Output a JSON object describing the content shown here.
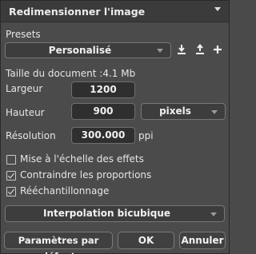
{
  "header": {
    "title": "Redimensionner l'image"
  },
  "presets": {
    "label": "Presets",
    "selected": "Personalisé"
  },
  "doc_size": {
    "label": "Taille du document :",
    "value": "4.1 Mb"
  },
  "width": {
    "label": "Largeur",
    "value": "1200"
  },
  "height": {
    "label": "Hauteur",
    "value": "900",
    "unit": "pixels"
  },
  "resolution": {
    "label": "Résolution",
    "value": "300.000",
    "unit": "ppi"
  },
  "options": [
    {
      "label": "Mise à l'échelle des effets",
      "checked": false
    },
    {
      "label": "Contraindre les proportions",
      "checked": true
    },
    {
      "label": "Rééchantillonnage",
      "checked": true
    }
  ],
  "interpolation": {
    "selected": "Interpolation bicubique"
  },
  "buttons": {
    "defaults": "Paramètres par défaut",
    "ok": "OK",
    "cancel": "Annuler"
  }
}
